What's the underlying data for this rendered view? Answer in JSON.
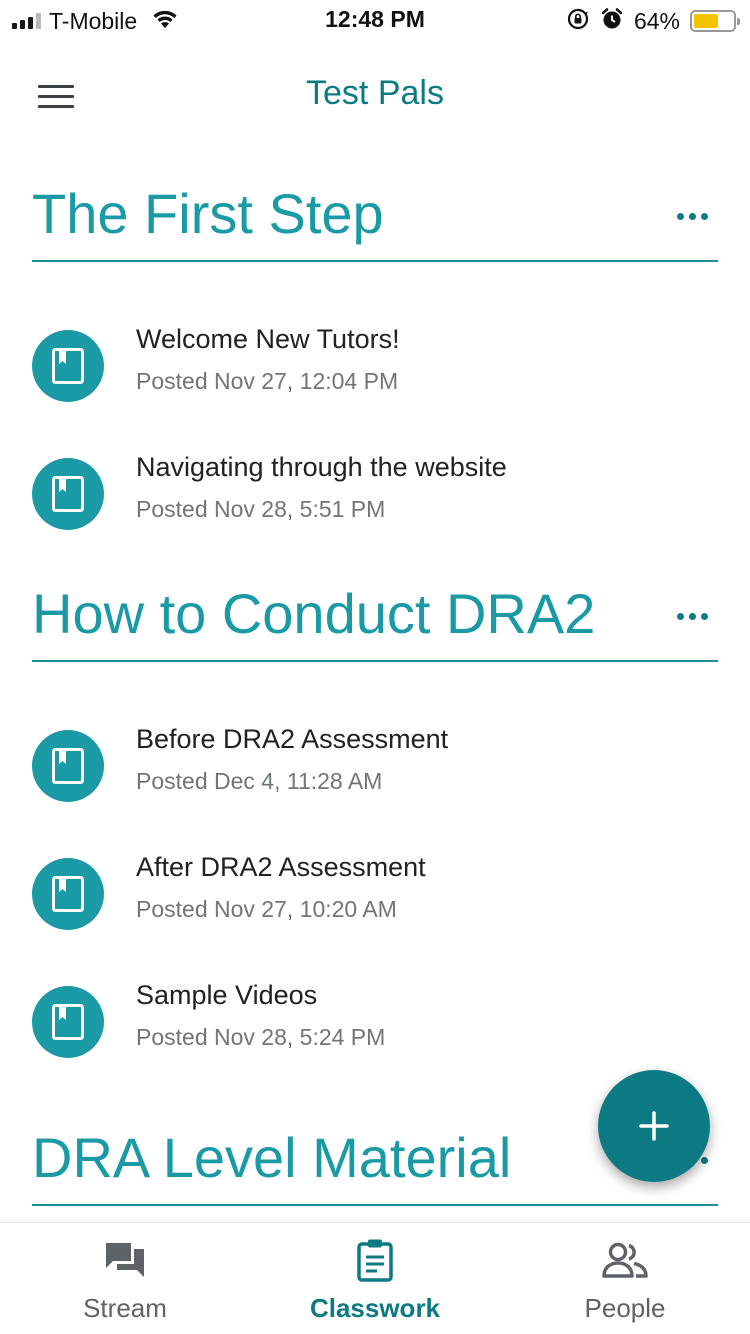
{
  "status_bar": {
    "carrier": "T-Mobile",
    "time": "12:48 PM",
    "battery_percent": "64%",
    "battery_level": 0.64,
    "icons": [
      "signal-icon",
      "wifi-icon",
      "orientation-lock-icon",
      "alarm-icon",
      "battery-icon"
    ]
  },
  "app_bar": {
    "title": "Test Pals",
    "menu_icon": "hamburger-menu-icon"
  },
  "topics": [
    {
      "title": "The First Step",
      "items": [
        {
          "title": "Welcome New Tutors!",
          "posted": "Posted Nov 27, 12:04 PM",
          "icon": "material-icon"
        },
        {
          "title": "Navigating through the website",
          "posted": "Posted Nov 28, 5:51 PM",
          "icon": "material-icon"
        }
      ]
    },
    {
      "title": "How to Conduct DRA2",
      "items": [
        {
          "title": "Before DRA2 Assessment",
          "posted": "Posted Dec 4, 11:28 AM",
          "icon": "material-icon"
        },
        {
          "title": "After DRA2 Assessment",
          "posted": "Posted Nov 27, 10:20 AM",
          "icon": "material-icon"
        },
        {
          "title": "Sample Videos",
          "posted": "Posted Nov 28, 5:24 PM",
          "icon": "material-icon"
        }
      ]
    },
    {
      "title": "DRA Level Material",
      "items": []
    }
  ],
  "fab": {
    "icon": "plus-icon"
  },
  "bottom_nav": {
    "items": [
      {
        "label": "Stream",
        "icon": "stream-icon",
        "active": false
      },
      {
        "label": "Classwork",
        "icon": "classwork-icon",
        "active": true
      },
      {
        "label": "People",
        "icon": "people-icon",
        "active": false
      }
    ]
  },
  "colors": {
    "accent": "#1a9aa5",
    "accent_dark": "#0b7a82",
    "text_primary": "#202124",
    "text_secondary": "#70757a",
    "battery": "#f5c400"
  }
}
